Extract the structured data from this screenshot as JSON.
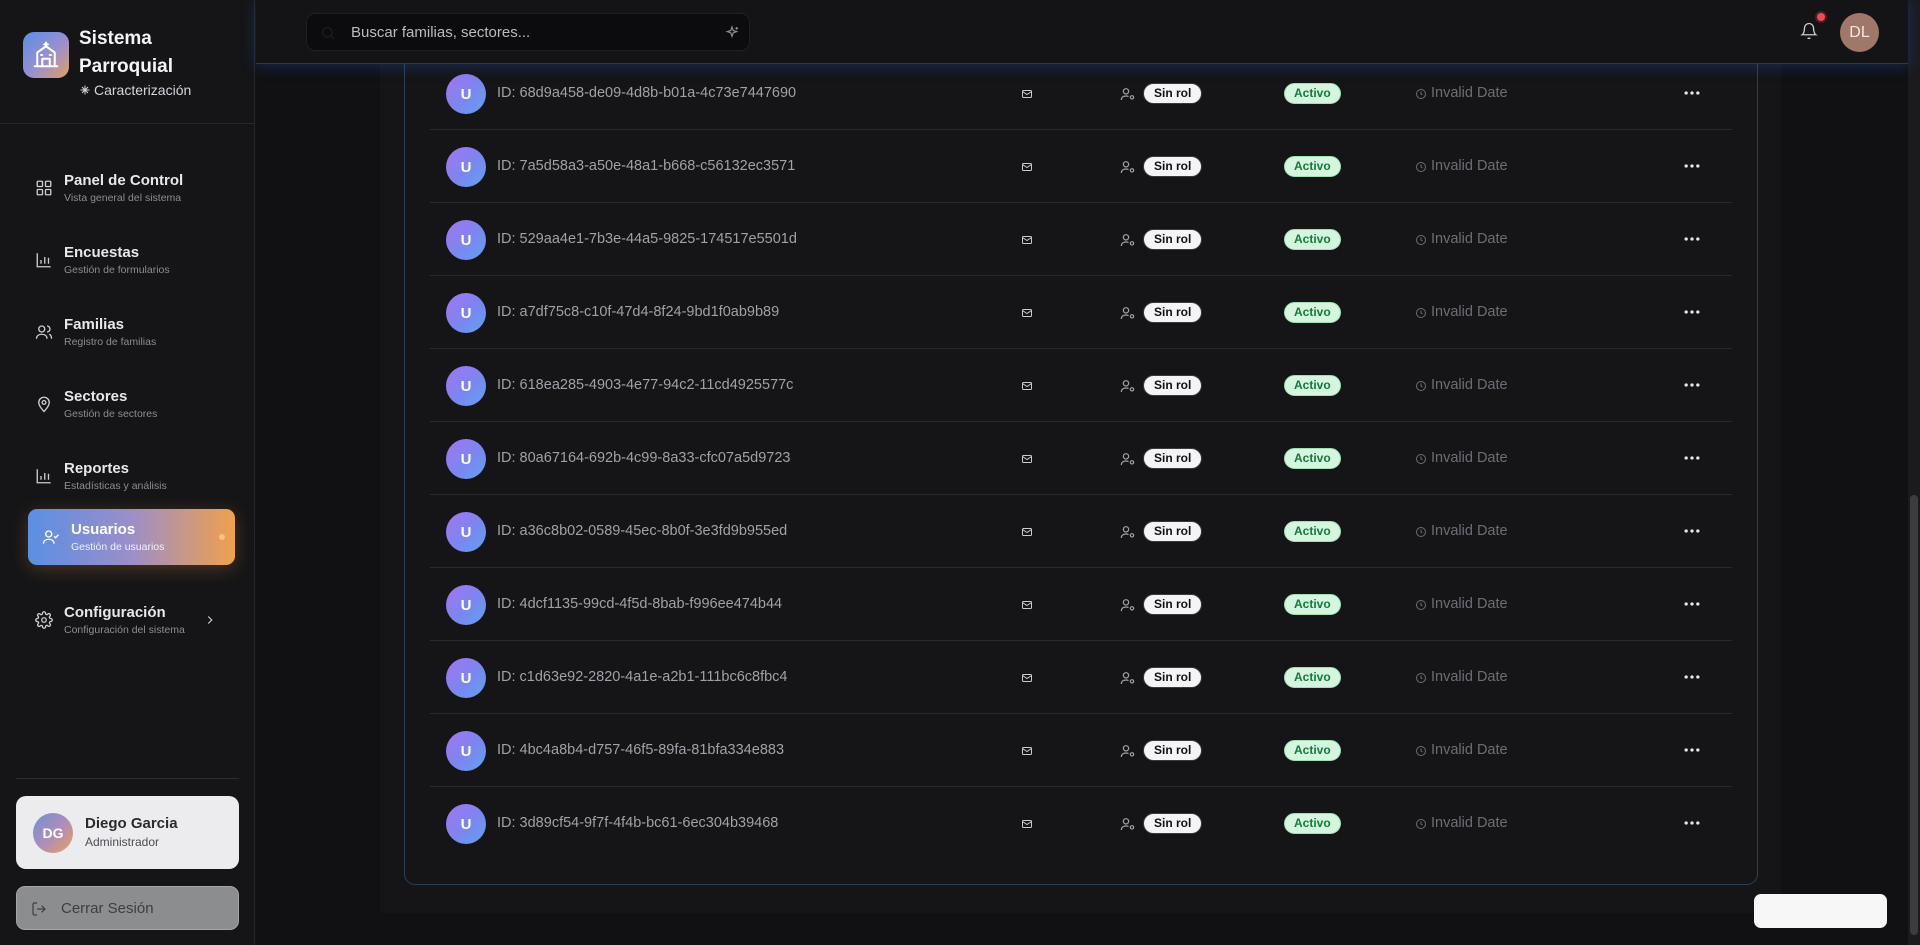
{
  "app": {
    "title": "Sistema Parroquial",
    "subtitle": "Caracterización"
  },
  "header": {
    "search_placeholder": "Buscar familias, sectores...",
    "avatar_initials": "DL"
  },
  "nav": [
    {
      "label": "Panel de Control",
      "desc": "Vista general del sistema",
      "icon": "dashboard-icon"
    },
    {
      "label": "Encuestas",
      "desc": "Gestión de formularios",
      "icon": "bar-chart-icon"
    },
    {
      "label": "Familias",
      "desc": "Registro de familias",
      "icon": "users-icon"
    },
    {
      "label": "Sectores",
      "desc": "Gestión de sectores",
      "icon": "map-pin-icon"
    },
    {
      "label": "Reportes",
      "desc": "Estadísticas y análisis",
      "icon": "bar-chart-icon"
    },
    {
      "label": "Usuarios",
      "desc": "Gestión de usuarios",
      "icon": "user-check-icon",
      "active": true
    },
    {
      "label": "Configuración",
      "desc": "Configuración del sistema",
      "icon": "gear-icon"
    }
  ],
  "user": {
    "initials": "DG",
    "name": "Diego Garcia",
    "role": "Administrador"
  },
  "logout_label": "Cerrar Sesión",
  "rows": [
    {
      "avatar": "U",
      "id": "ID: 68d9a458-de09-4d8b-b01a-4c73e7447690",
      "role": "Sin rol",
      "status": "Activo",
      "date": "Invalid Date"
    },
    {
      "avatar": "U",
      "id": "ID: 7a5d58a3-a50e-48a1-b668-c56132ec3571",
      "role": "Sin rol",
      "status": "Activo",
      "date": "Invalid Date"
    },
    {
      "avatar": "U",
      "id": "ID: 529aa4e1-7b3e-44a5-9825-174517e5501d",
      "role": "Sin rol",
      "status": "Activo",
      "date": "Invalid Date"
    },
    {
      "avatar": "U",
      "id": "ID: a7df75c8-c10f-47d4-8f24-9bd1f0ab9b89",
      "role": "Sin rol",
      "status": "Activo",
      "date": "Invalid Date"
    },
    {
      "avatar": "U",
      "id": "ID: 618ea285-4903-4e77-94c2-11cd4925577c",
      "role": "Sin rol",
      "status": "Activo",
      "date": "Invalid Date"
    },
    {
      "avatar": "U",
      "id": "ID: 80a67164-692b-4c99-8a33-cfc07a5d9723",
      "role": "Sin rol",
      "status": "Activo",
      "date": "Invalid Date"
    },
    {
      "avatar": "U",
      "id": "ID: a36c8b02-0589-45ec-8b0f-3e3fd9b955ed",
      "role": "Sin rol",
      "status": "Activo",
      "date": "Invalid Date"
    },
    {
      "avatar": "U",
      "id": "ID: 4dcf1135-99cd-4f5d-8bab-f996ee474b44",
      "role": "Sin rol",
      "status": "Activo",
      "date": "Invalid Date"
    },
    {
      "avatar": "U",
      "id": "ID: c1d63e92-2820-4a1e-a2b1-111bc6c8fbc4",
      "role": "Sin rol",
      "status": "Activo",
      "date": "Invalid Date"
    },
    {
      "avatar": "U",
      "id": "ID: 4bc4a8b4-d757-46f5-89fa-81bfa334e883",
      "role": "Sin rol",
      "status": "Activo",
      "date": "Invalid Date"
    },
    {
      "avatar": "U",
      "id": "ID: 3d89cf54-9f7f-4f4b-bc61-6ec304b39468",
      "role": "Sin rol",
      "status": "Activo",
      "date": "Invalid Date"
    }
  ],
  "colors": {
    "accent_start": "#5b8fe3",
    "accent_end": "#f0a04b",
    "status_active_bg": "#d5f5df",
    "status_active_text": "#127a3c"
  }
}
